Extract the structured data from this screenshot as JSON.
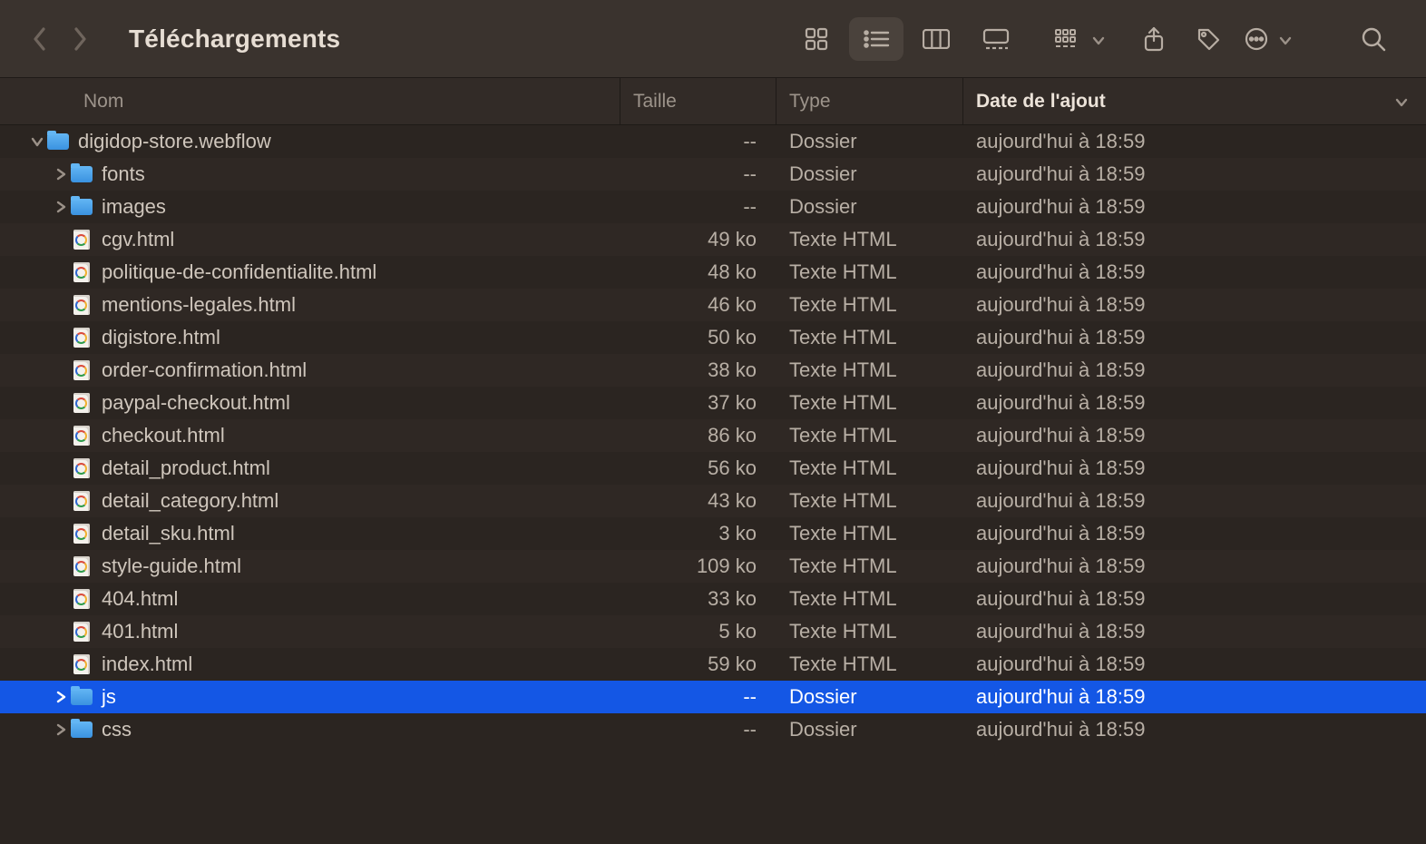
{
  "window": {
    "title": "Téléchargements"
  },
  "columns": {
    "name": "Nom",
    "size": "Taille",
    "type": "Type",
    "date": "Date de l'ajout"
  },
  "rows": [
    {
      "depth": 0,
      "disclosure": "down",
      "icon": "folder",
      "name": "digidop-store.webflow",
      "size": "--",
      "type": "Dossier",
      "date": "aujourd'hui à 18:59",
      "selected": false
    },
    {
      "depth": 1,
      "disclosure": "right",
      "icon": "folder",
      "name": "fonts",
      "size": "--",
      "type": "Dossier",
      "date": "aujourd'hui à 18:59",
      "selected": false
    },
    {
      "depth": 1,
      "disclosure": "right",
      "icon": "folder",
      "name": "images",
      "size": "--",
      "type": "Dossier",
      "date": "aujourd'hui à 18:59",
      "selected": false
    },
    {
      "depth": 1,
      "disclosure": "none",
      "icon": "html",
      "name": "cgv.html",
      "size": "49 ko",
      "type": "Texte HTML",
      "date": "aujourd'hui à 18:59",
      "selected": false
    },
    {
      "depth": 1,
      "disclosure": "none",
      "icon": "html",
      "name": "politique-de-confidentialite.html",
      "size": "48 ko",
      "type": "Texte HTML",
      "date": "aujourd'hui à 18:59",
      "selected": false
    },
    {
      "depth": 1,
      "disclosure": "none",
      "icon": "html",
      "name": "mentions-legales.html",
      "size": "46 ko",
      "type": "Texte HTML",
      "date": "aujourd'hui à 18:59",
      "selected": false
    },
    {
      "depth": 1,
      "disclosure": "none",
      "icon": "html",
      "name": "digistore.html",
      "size": "50 ko",
      "type": "Texte HTML",
      "date": "aujourd'hui à 18:59",
      "selected": false
    },
    {
      "depth": 1,
      "disclosure": "none",
      "icon": "html",
      "name": "order-confirmation.html",
      "size": "38 ko",
      "type": "Texte HTML",
      "date": "aujourd'hui à 18:59",
      "selected": false
    },
    {
      "depth": 1,
      "disclosure": "none",
      "icon": "html",
      "name": "paypal-checkout.html",
      "size": "37 ko",
      "type": "Texte HTML",
      "date": "aujourd'hui à 18:59",
      "selected": false
    },
    {
      "depth": 1,
      "disclosure": "none",
      "icon": "html",
      "name": "checkout.html",
      "size": "86 ko",
      "type": "Texte HTML",
      "date": "aujourd'hui à 18:59",
      "selected": false
    },
    {
      "depth": 1,
      "disclosure": "none",
      "icon": "html",
      "name": "detail_product.html",
      "size": "56 ko",
      "type": "Texte HTML",
      "date": "aujourd'hui à 18:59",
      "selected": false
    },
    {
      "depth": 1,
      "disclosure": "none",
      "icon": "html",
      "name": "detail_category.html",
      "size": "43 ko",
      "type": "Texte HTML",
      "date": "aujourd'hui à 18:59",
      "selected": false
    },
    {
      "depth": 1,
      "disclosure": "none",
      "icon": "html",
      "name": "detail_sku.html",
      "size": "3 ko",
      "type": "Texte HTML",
      "date": "aujourd'hui à 18:59",
      "selected": false
    },
    {
      "depth": 1,
      "disclosure": "none",
      "icon": "html",
      "name": "style-guide.html",
      "size": "109 ko",
      "type": "Texte HTML",
      "date": "aujourd'hui à 18:59",
      "selected": false
    },
    {
      "depth": 1,
      "disclosure": "none",
      "icon": "html",
      "name": "404.html",
      "size": "33 ko",
      "type": "Texte HTML",
      "date": "aujourd'hui à 18:59",
      "selected": false
    },
    {
      "depth": 1,
      "disclosure": "none",
      "icon": "html",
      "name": "401.html",
      "size": "5 ko",
      "type": "Texte HTML",
      "date": "aujourd'hui à 18:59",
      "selected": false
    },
    {
      "depth": 1,
      "disclosure": "none",
      "icon": "html",
      "name": "index.html",
      "size": "59 ko",
      "type": "Texte HTML",
      "date": "aujourd'hui à 18:59",
      "selected": false
    },
    {
      "depth": 1,
      "disclosure": "right",
      "icon": "folder",
      "name": "js",
      "size": "--",
      "type": "Dossier",
      "date": "aujourd'hui à 18:59",
      "selected": true
    },
    {
      "depth": 1,
      "disclosure": "right",
      "icon": "folder",
      "name": "css",
      "size": "--",
      "type": "Dossier",
      "date": "aujourd'hui à 18:59",
      "selected": false
    }
  ]
}
